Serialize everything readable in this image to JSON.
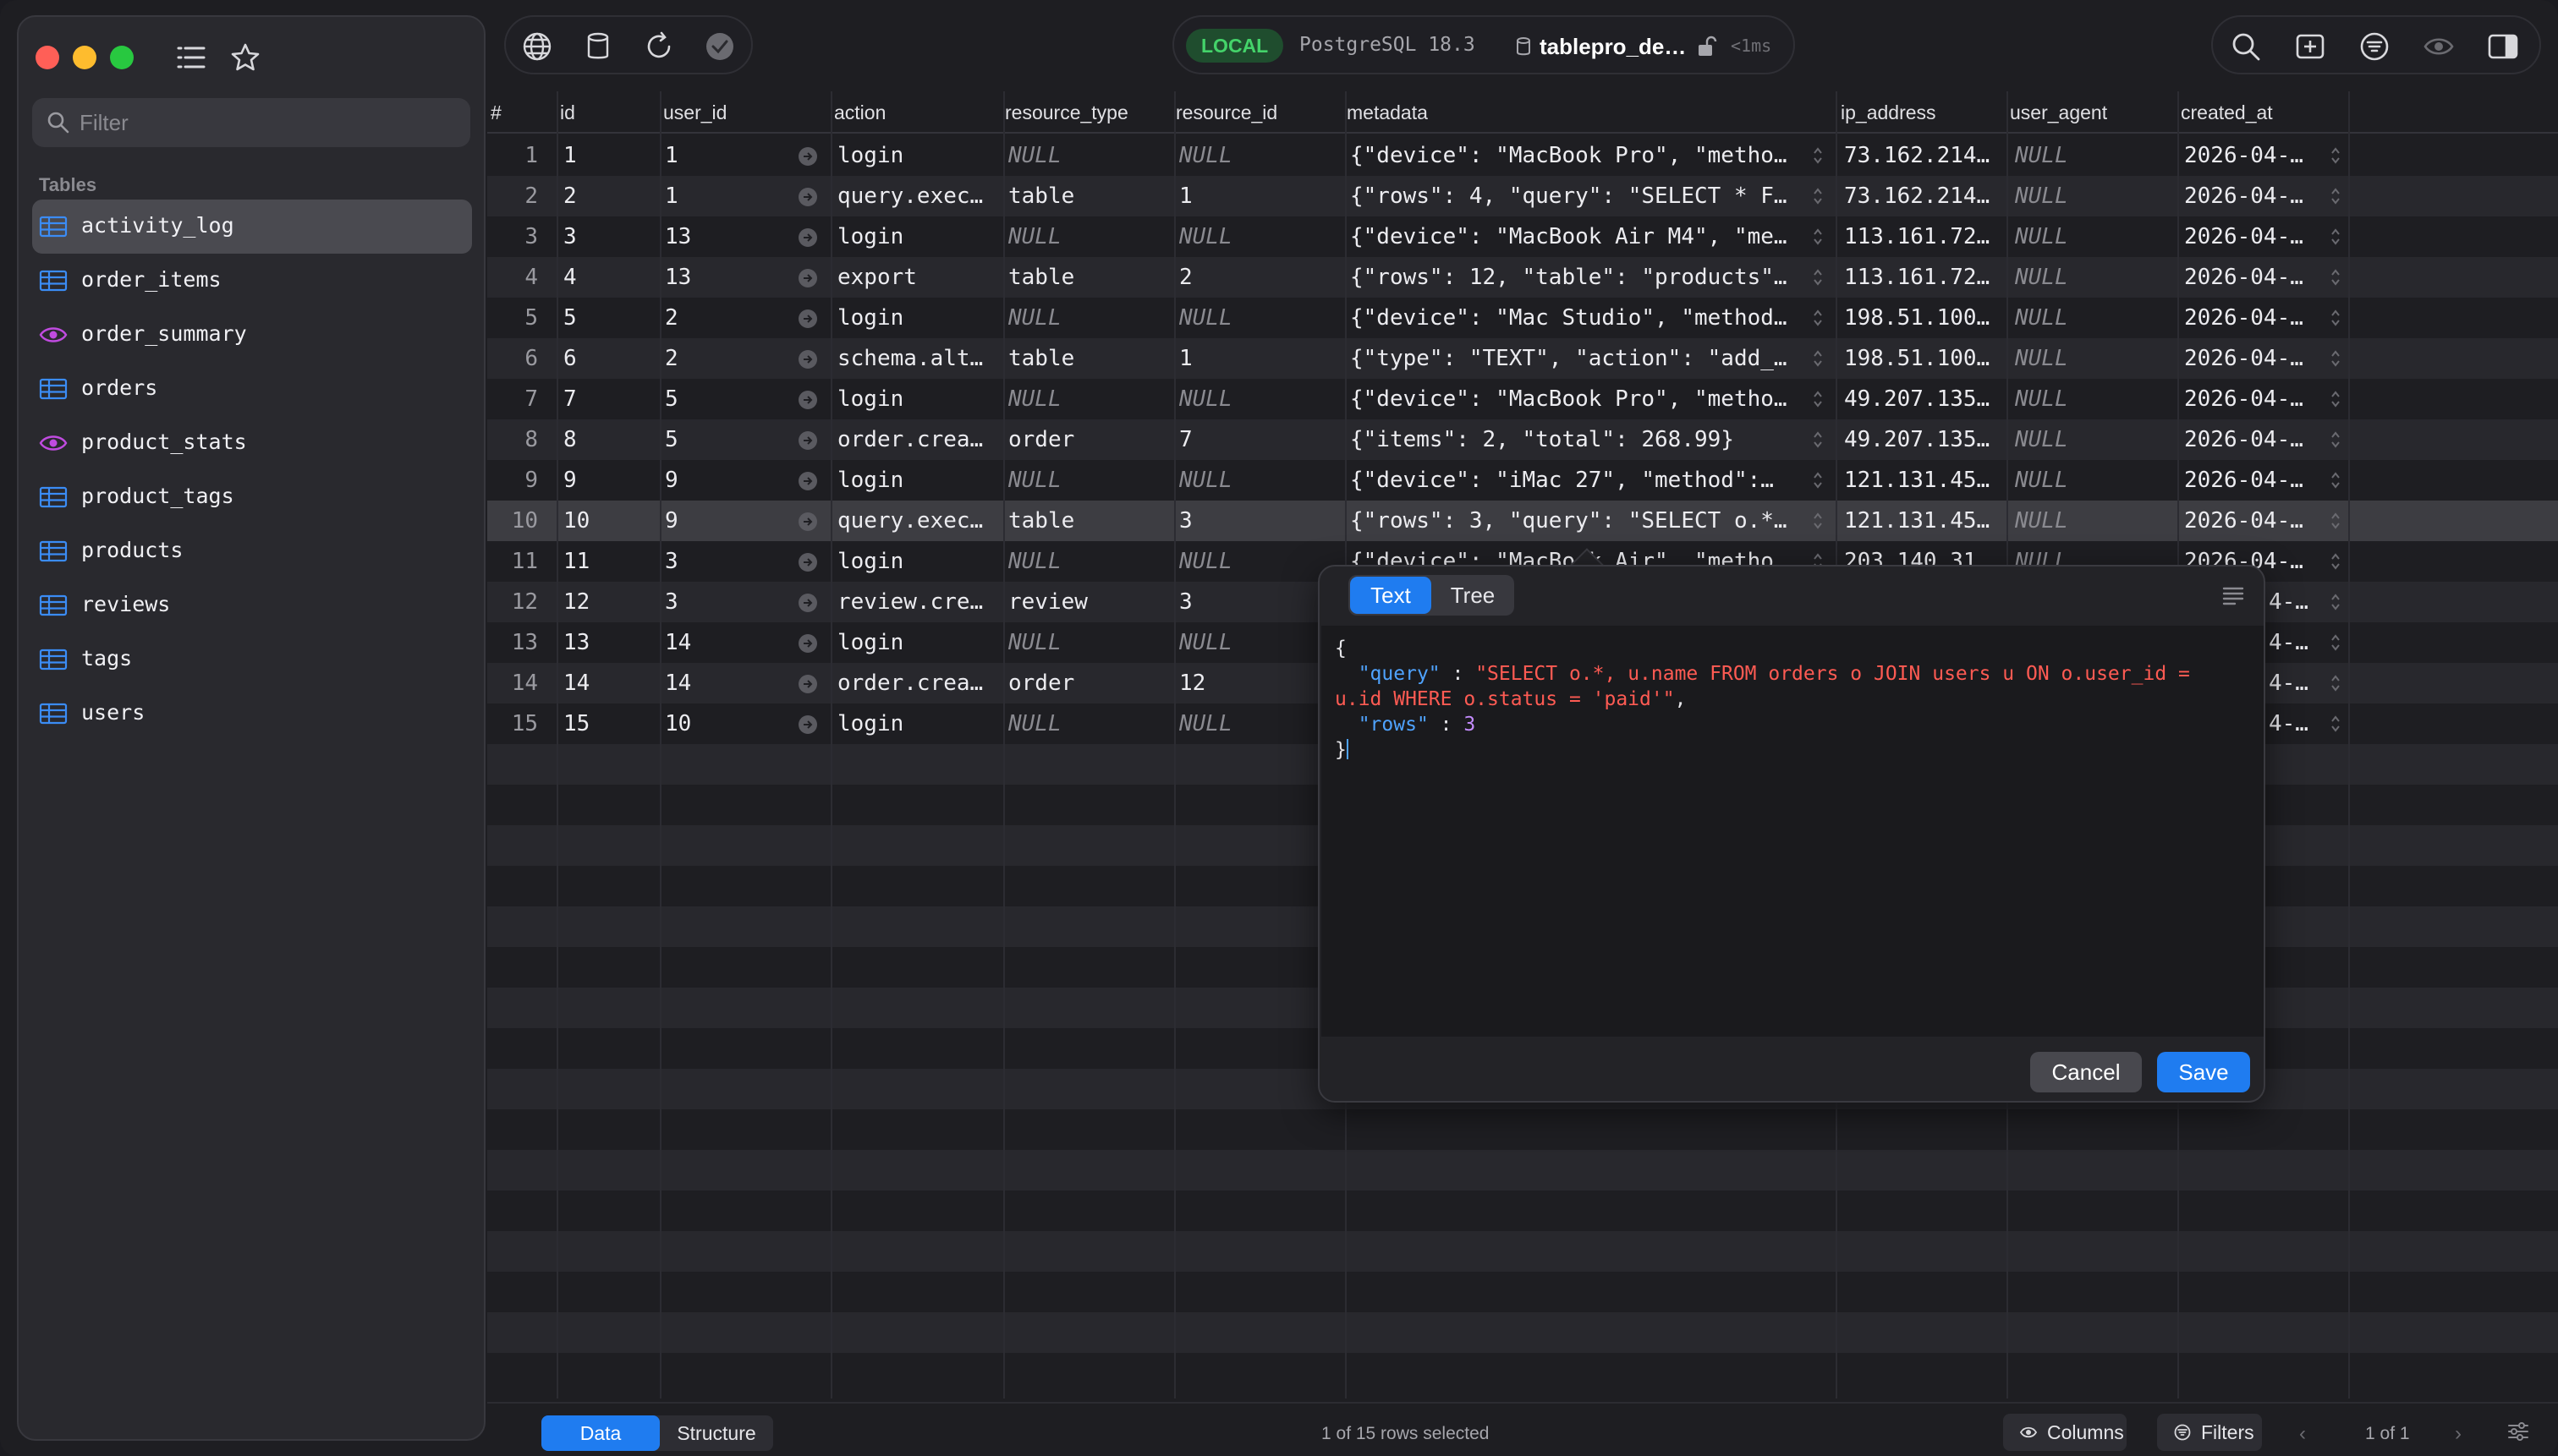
{
  "sidebar": {
    "filter_placeholder": "Filter",
    "section_label": "Tables",
    "items": [
      {
        "label": "activity_log",
        "kind": "table",
        "selected": true
      },
      {
        "label": "order_items",
        "kind": "table"
      },
      {
        "label": "order_summary",
        "kind": "view"
      },
      {
        "label": "orders",
        "kind": "table"
      },
      {
        "label": "product_stats",
        "kind": "view"
      },
      {
        "label": "product_tags",
        "kind": "table"
      },
      {
        "label": "products",
        "kind": "table"
      },
      {
        "label": "reviews",
        "kind": "table"
      },
      {
        "label": "tags",
        "kind": "table"
      },
      {
        "label": "users",
        "kind": "table"
      }
    ]
  },
  "connection": {
    "badge": "LOCAL",
    "database": "PostgreSQL 18.3",
    "name": "tablepro_de…",
    "latency": "<1ms"
  },
  "grid": {
    "columns": [
      "#",
      "id",
      "user_id",
      "action",
      "resource_type",
      "resource_id",
      "metadata",
      "ip_address",
      "user_agent",
      "created_at"
    ],
    "rows": [
      [
        "1",
        "1",
        "1",
        "login",
        "NULL",
        "NULL",
        "{\"device\": \"MacBook Pro\", \"metho…",
        "73.162.214…",
        "NULL",
        "2026-04-…"
      ],
      [
        "2",
        "2",
        "1",
        "query.exec…",
        "table",
        "1",
        "{\"rows\": 4, \"query\": \"SELECT * F…",
        "73.162.214…",
        "NULL",
        "2026-04-…"
      ],
      [
        "3",
        "3",
        "13",
        "login",
        "NULL",
        "NULL",
        "{\"device\": \"MacBook Air M4\", \"me…",
        "113.161.72…",
        "NULL",
        "2026-04-…"
      ],
      [
        "4",
        "4",
        "13",
        "export",
        "table",
        "2",
        "{\"rows\": 12, \"table\": \"products\"…",
        "113.161.72…",
        "NULL",
        "2026-04-…"
      ],
      [
        "5",
        "5",
        "2",
        "login",
        "NULL",
        "NULL",
        "{\"device\": \"Mac Studio\", \"method…",
        "198.51.100…",
        "NULL",
        "2026-04-…"
      ],
      [
        "6",
        "6",
        "2",
        "schema.alt…",
        "table",
        "1",
        "{\"type\": \"TEXT\", \"action\": \"add_…",
        "198.51.100…",
        "NULL",
        "2026-04-…"
      ],
      [
        "7",
        "7",
        "5",
        "login",
        "NULL",
        "NULL",
        "{\"device\": \"MacBook Pro\", \"metho…",
        "49.207.135…",
        "NULL",
        "2026-04-…"
      ],
      [
        "8",
        "8",
        "5",
        "order.crea…",
        "order",
        "7",
        "{\"items\": 2, \"total\": 268.99}",
        "49.207.135…",
        "NULL",
        "2026-04-…"
      ],
      [
        "9",
        "9",
        "9",
        "login",
        "NULL",
        "NULL",
        "{\"device\": \"iMac 27\", \"method\":…",
        "121.131.45…",
        "NULL",
        "2026-04-…"
      ],
      [
        "10",
        "10",
        "9",
        "query.exec…",
        "table",
        "3",
        "{\"rows\": 3, \"query\": \"SELECT o.*…",
        "121.131.45…",
        "NULL",
        "2026-04-…"
      ],
      [
        "11",
        "11",
        "3",
        "login",
        "NULL",
        "NULL",
        "{\"device\": \"MacBook Air\", \"metho…",
        "203.140.31…",
        "NULL",
        "2026-04-…"
      ],
      [
        "12",
        "12",
        "3",
        "review.cre…",
        "review",
        "3",
        "",
        "",
        "",
        "4-…"
      ],
      [
        "13",
        "13",
        "14",
        "login",
        "NULL",
        "NULL",
        "",
        "",
        "",
        "4-…"
      ],
      [
        "14",
        "14",
        "14",
        "order.crea…",
        "order",
        "12",
        "",
        "",
        "",
        "4-…"
      ],
      [
        "15",
        "15",
        "10",
        "login",
        "NULL",
        "NULL",
        "",
        "",
        "",
        "4-…"
      ]
    ],
    "selected_row": 10
  },
  "popover": {
    "tab_text": "Text",
    "tab_tree": "Tree",
    "line_open": "{",
    "key_query": "\"query\"",
    "sep": " : ",
    "val_query_1": "\"SELECT o.*, u.name FROM orders o JOIN users u ON o.user_id =",
    "val_query_2": "u.id WHERE o.status = 'paid'\"",
    "comma": ",",
    "key_rows": "\"rows\"",
    "val_rows": "3",
    "line_close": "}",
    "cancel_label": "Cancel",
    "save_label": "Save"
  },
  "footer": {
    "tab_data": "Data",
    "tab_structure": "Structure",
    "status": "1 of 15 rows selected",
    "columns_label": "Columns",
    "filters_label": "Filters",
    "pagination": "1 of 1"
  },
  "colors": {
    "accent": "#1f7cf0",
    "local_badge": "#44d36a",
    "json_key": "#4fa3ff",
    "json_string": "#ff5b53",
    "json_number": "#c58cff",
    "view_icon": "#c04be0",
    "table_icon": "#3b8cf5"
  }
}
